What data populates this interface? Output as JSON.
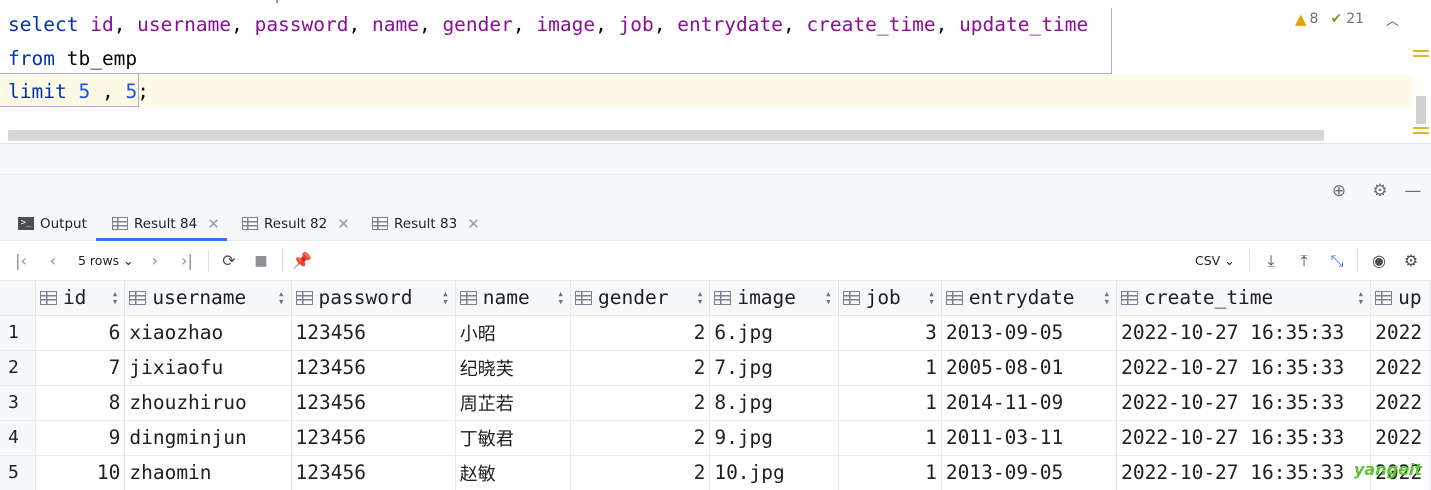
{
  "editor": {
    "sql_keywords": {
      "select": "select",
      "from": "from",
      "limit": "limit"
    },
    "select_columns": [
      "id",
      "username",
      "password",
      "name",
      "gender",
      "image",
      "job",
      "entrydate",
      "create_time",
      "update_time"
    ],
    "table_name": "tb_emp",
    "limit_offset": "5",
    "limit_count": "5",
    "inspections": {
      "warnings": "8",
      "weak_warnings": "21"
    }
  },
  "tabs": [
    {
      "label": "Output",
      "active": false
    },
    {
      "label": "Result 84",
      "active": true
    },
    {
      "label": "Result 82",
      "active": false
    },
    {
      "label": "Result 83",
      "active": false
    }
  ],
  "toolbar": {
    "rows_label": "5 rows",
    "export_format": "CSV"
  },
  "grid": {
    "columns": [
      "id",
      "username",
      "password",
      "name",
      "gender",
      "image",
      "job",
      "entrydate",
      "create_time",
      "up"
    ],
    "rows": [
      {
        "row_no": "1",
        "id": "6",
        "username": "xiaozhao",
        "password": "123456",
        "name": "小昭",
        "gender": "2",
        "image": "6.jpg",
        "job": "3",
        "entrydate": "2013-09-05",
        "create_time": "2022-10-27 16:35:33",
        "update_time": "2022"
      },
      {
        "row_no": "2",
        "id": "7",
        "username": "jixiaofu",
        "password": "123456",
        "name": "纪晓芙",
        "gender": "2",
        "image": "7.jpg",
        "job": "1",
        "entrydate": "2005-08-01",
        "create_time": "2022-10-27 16:35:33",
        "update_time": "2022"
      },
      {
        "row_no": "3",
        "id": "8",
        "username": "zhouzhiruo",
        "password": "123456",
        "name": "周芷若",
        "gender": "2",
        "image": "8.jpg",
        "job": "1",
        "entrydate": "2014-11-09",
        "create_time": "2022-10-27 16:35:33",
        "update_time": "2022"
      },
      {
        "row_no": "4",
        "id": "9",
        "username": "dingminjun",
        "password": "123456",
        "name": "丁敏君",
        "gender": "2",
        "image": "9.jpg",
        "job": "1",
        "entrydate": "2011-03-11",
        "create_time": "2022-10-27 16:35:33",
        "update_time": "2022"
      },
      {
        "row_no": "5",
        "id": "10",
        "username": "zhaomin",
        "password": "123456",
        "name": "赵敏",
        "gender": "2",
        "image": "10.jpg",
        "job": "1",
        "entrydate": "2013-09-05",
        "create_time": "2022-10-27 16:35:33",
        "update_time": "2022"
      }
    ]
  },
  "watermark": "yangeit"
}
